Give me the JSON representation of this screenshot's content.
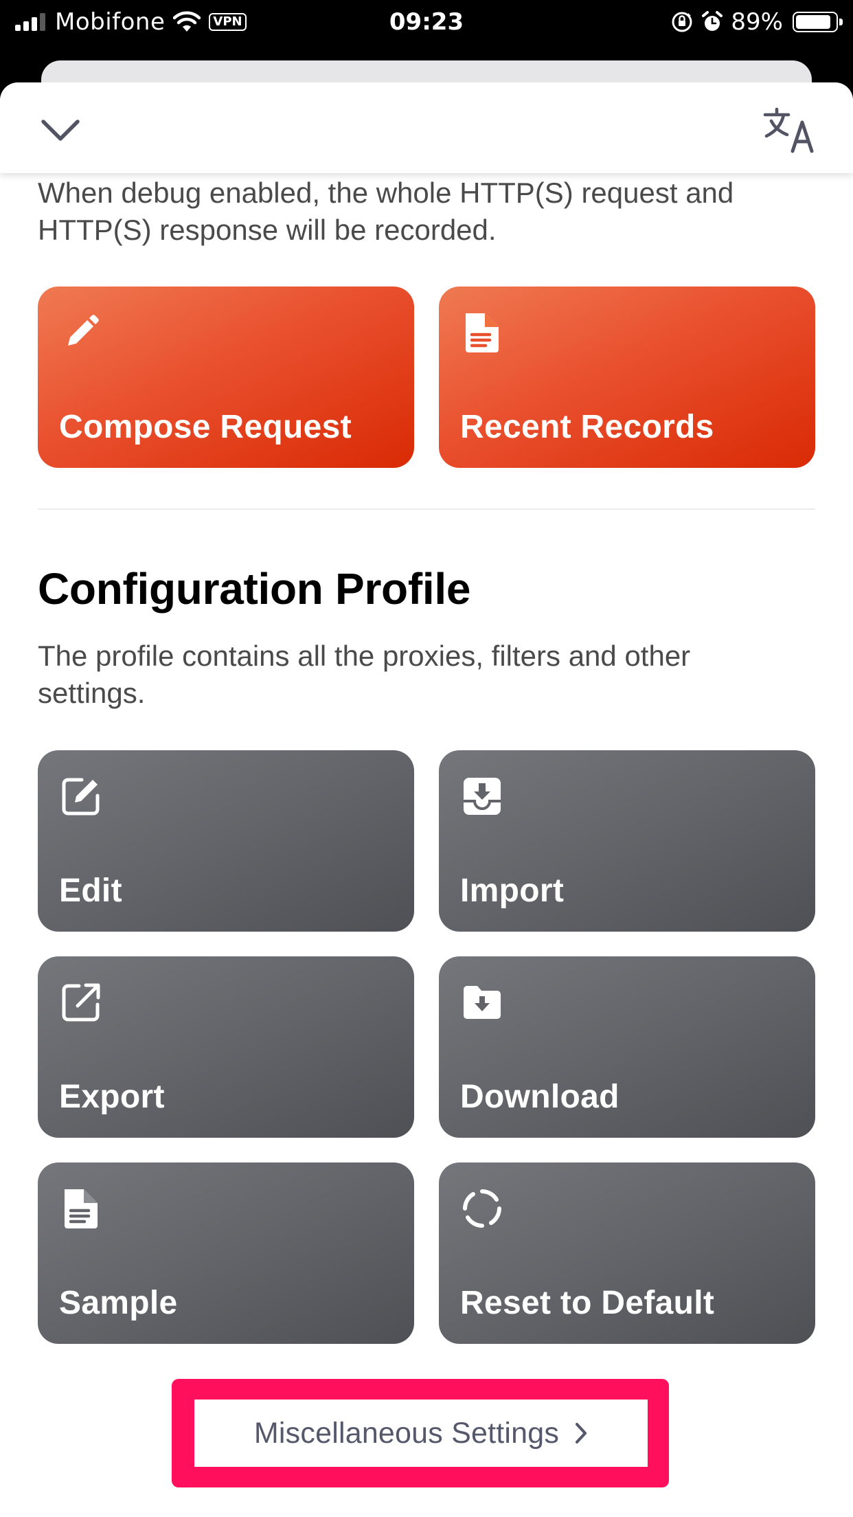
{
  "status_bar": {
    "carrier": "Mobifone",
    "vpn": "VPN",
    "time": "09:23",
    "battery_percent": "89%",
    "battery_level": 0.89,
    "signal_bars": 3
  },
  "header": {
    "collapse_icon": "chevron-down-icon",
    "translate_icon": "translate-icon"
  },
  "debug": {
    "description": "When debug enabled, the whole HTTP(S) request and HTTP(S) response will be recorded."
  },
  "debug_actions": [
    {
      "label": "Compose Request",
      "icon": "pencil-icon"
    },
    {
      "label": "Recent Records",
      "icon": "document-icon"
    }
  ],
  "profile": {
    "title": "Configuration Profile",
    "description": "The profile contains all the proxies, filters and other settings.",
    "actions": [
      {
        "label": "Edit",
        "icon": "edit-icon"
      },
      {
        "label": "Import",
        "icon": "import-icon"
      },
      {
        "label": "Export",
        "icon": "export-icon"
      },
      {
        "label": "Download",
        "icon": "download-folder-icon"
      },
      {
        "label": "Sample",
        "icon": "document-icon"
      },
      {
        "label": "Reset to Default",
        "icon": "reset-icon"
      }
    ]
  },
  "misc": {
    "label": "Miscellaneous Settings",
    "icon": "chevron-right-icon",
    "highlight_color": "#ff0f5c"
  },
  "colors": {
    "accent_orange": "#e9502e",
    "tile_gray": "#636469",
    "text_secondary": "#4a4a4a"
  }
}
